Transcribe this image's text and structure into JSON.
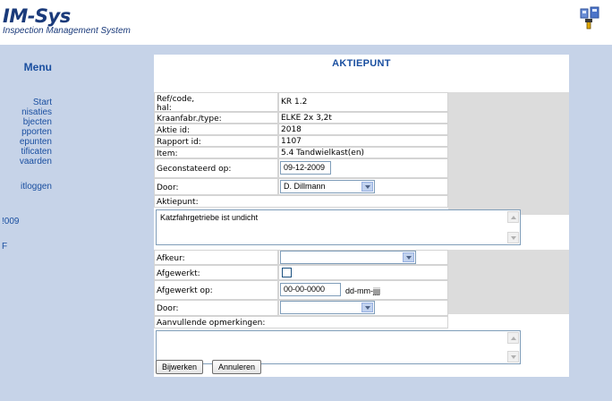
{
  "header": {
    "logo_title": "IM-Sys",
    "logo_subtitle": "Inspection Management System",
    "icon": "tools-icon"
  },
  "sidebar": {
    "menu_title": "Menu",
    "items": [
      {
        "label": "Start"
      },
      {
        "label": "nisaties"
      },
      {
        "label": "bjecten"
      },
      {
        "label": "pporten"
      },
      {
        "label": "epunten"
      },
      {
        "label": "tificaten"
      },
      {
        "label": "vaarden"
      },
      {
        "label": "itloggen"
      },
      {
        "label": "!009"
      },
      {
        "label": "F"
      }
    ]
  },
  "form": {
    "title": "AKTIEPUNT",
    "fields": {
      "ref_label": "Ref/code,\nhal:",
      "ref_value": "KR 1.2",
      "kraan_label": "Kraanfabr./type:",
      "kraan_value": "ELKE 2x 3,2t",
      "aktie_label": "Aktie id:",
      "aktie_value": "2018",
      "rapport_label": "Rapport id:",
      "rapport_value": "1107",
      "item_label": "Item:",
      "item_value": "5.4 Tandwielkast(en)",
      "geconst_label": "Geconstateerd op:",
      "geconst_value": "09-12-2009",
      "door_label": "Door:",
      "door_value": "D. Dillmann",
      "aktiepunt_label": "Aktiepunt:",
      "aktiepunt_value": "Katzfahrgetriebe ist undicht",
      "afkeur_label": "Afkeur:",
      "afkeur_value": "",
      "afgewerkt_label": "Afgewerkt:",
      "afgewerkt_op_label": "Afgewerkt op:",
      "afgewerkt_op_value": "00-00-0000",
      "date_hint": "dd-mm-jjjj",
      "door2_label": "Door:",
      "door2_value": "",
      "opm_label": "Aanvullende opmerkingen:",
      "opm_value": ""
    },
    "buttons": {
      "update": "Bijwerken",
      "cancel": "Annuleren"
    }
  }
}
